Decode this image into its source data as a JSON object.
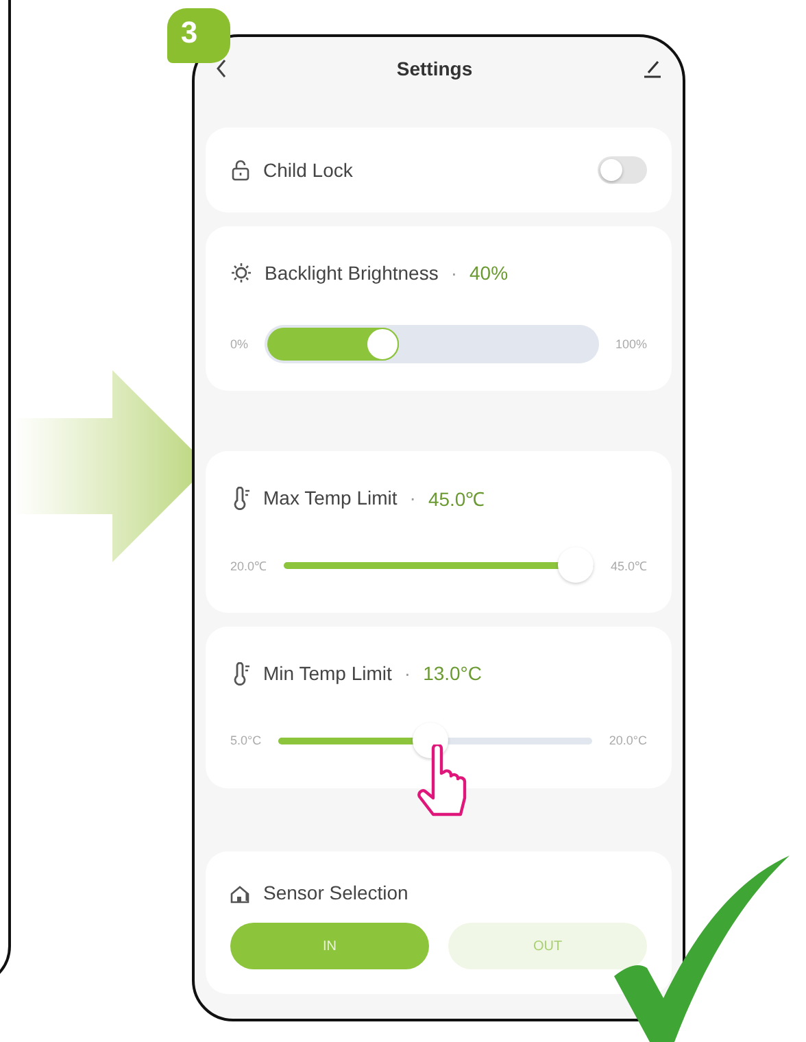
{
  "badge": "3",
  "header": {
    "title": "Settings"
  },
  "child_lock": {
    "label": "Child Lock",
    "on": false
  },
  "sliders": [
    {
      "kind": "thick",
      "label": "Backlight Brightness",
      "separator": "·",
      "value": "40%",
      "min_label": "0%",
      "max_label": "100%",
      "level": 0.4
    },
    {
      "kind": "thin",
      "label": "Max Temp Limit",
      "separator": "·",
      "value": "45.0℃",
      "min_label": "20.0℃",
      "max_label": "45.0℃",
      "level": 1.0
    },
    {
      "kind": "thin",
      "label": "Min Temp Limit",
      "separator": "·",
      "value": "13.0°C",
      "min_label": "5.0°C",
      "max_label": "20.0°C",
      "level": 0.54
    }
  ],
  "sensor": {
    "label": "Sensor Selection",
    "options": [
      {
        "label": "IN",
        "selected": true
      },
      {
        "label": "OUT",
        "selected": false
      }
    ]
  }
}
